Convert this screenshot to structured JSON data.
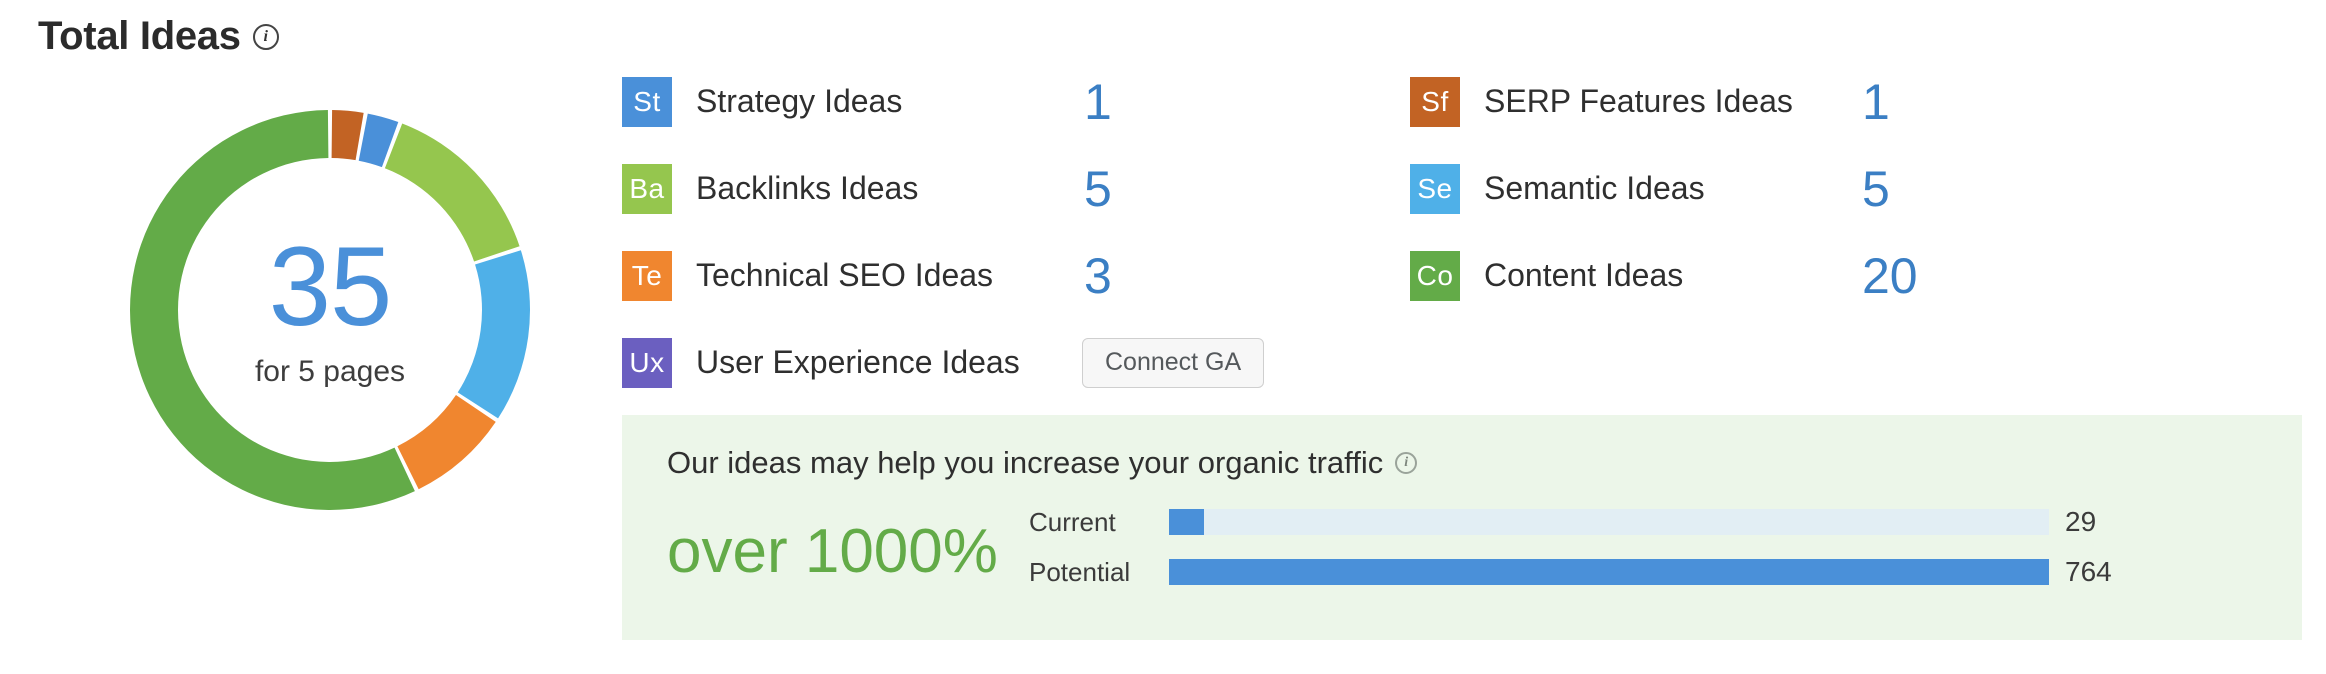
{
  "header": {
    "title": "Total Ideas",
    "info_icon": "info-icon",
    "info_glyph": "i"
  },
  "donut": {
    "total": "35",
    "subtitle": "for 5 pages"
  },
  "legend": {
    "left_column": [
      {
        "badge": "St",
        "badge_color": "#4a90d9",
        "label": "Strategy Ideas",
        "value": "1"
      },
      {
        "badge": "Ba",
        "badge_color": "#95c64e",
        "label": "Backlinks Ideas",
        "value": "5"
      },
      {
        "badge": "Te",
        "badge_color": "#f0862f",
        "label": "Technical SEO Ideas",
        "value": "3"
      },
      {
        "badge": "Ux",
        "badge_color": "#6b5fc0",
        "label": "User Experience Ideas",
        "value": "",
        "button_label": "Connect GA"
      }
    ],
    "right_column": [
      {
        "badge": "Sf",
        "badge_color": "#c26324",
        "label": "SERP Features Ideas",
        "value": "1"
      },
      {
        "badge": "Se",
        "badge_color": "#4fb0e8",
        "label": "Semantic Ideas",
        "value": "5"
      },
      {
        "badge": "Co",
        "badge_color": "#63ab48",
        "label": "Content Ideas",
        "value": "20"
      }
    ]
  },
  "banner": {
    "headline": "Our ideas may help you increase your organic traffic",
    "info_glyph": "i",
    "uplift": "over 1000%",
    "uplift_color": "#63ab48",
    "background": "#ecf6e9",
    "bars": [
      {
        "label": "Current",
        "value": "29",
        "fill_pct": 4
      },
      {
        "label": "Potential",
        "value": "764",
        "fill_pct": 100
      }
    ]
  },
  "chart_data": {
    "type": "pie",
    "title": "Total Ideas",
    "center_value": 35,
    "center_label": "for 5 pages",
    "categories": [
      "SERP Features Ideas",
      "Strategy Ideas",
      "Backlinks Ideas",
      "Semantic Ideas",
      "Technical SEO Ideas",
      "Content Ideas"
    ],
    "values": [
      1,
      1,
      5,
      5,
      3,
      20
    ],
    "colors": [
      "#c26324",
      "#4a90d9",
      "#95c64e",
      "#4fb0e8",
      "#f0862f",
      "#63ab48"
    ],
    "total": 35,
    "legend_position": "right",
    "donut": true,
    "xlabel": "",
    "ylabel": ""
  }
}
